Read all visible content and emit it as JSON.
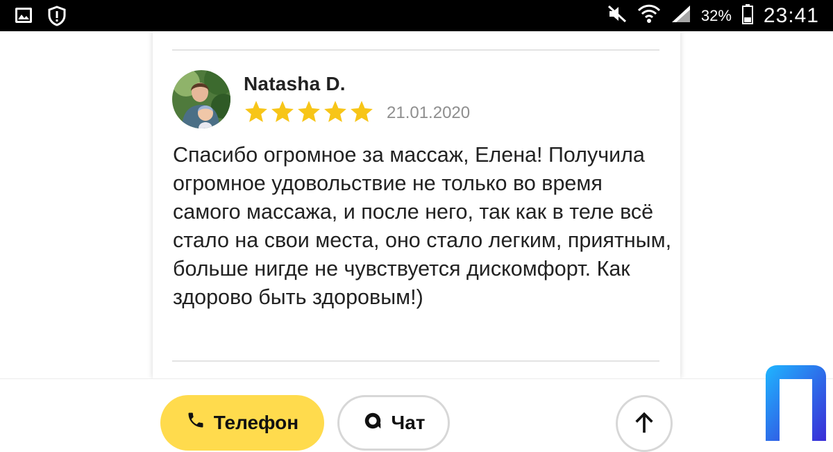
{
  "status_bar": {
    "left_icons": [
      "image-notification-icon",
      "shield-alert-icon"
    ],
    "right_icons": [
      "mute-icon",
      "wifi-icon",
      "signal-icon",
      "battery-icon"
    ],
    "battery_percent": "32%",
    "time": "23:41"
  },
  "review": {
    "author": "Natasha D.",
    "rating": 5,
    "rating_max": 5,
    "date": "21.01.2020",
    "text": "Спасибо огромное за массаж, Елена! Получила огромное удовольствие не только во время самого массажа, и после него, так как в теле всё стало на свои места, оно стало легким, приятным, больше нигде не чувствуется дискомфорт. Как здорово быть здоровым!)"
  },
  "actions": {
    "phone_label": "Телефон",
    "chat_label": "Чат"
  },
  "colors": {
    "star": "#f7c518",
    "phone_button": "#ffdb4d",
    "status_bar": "#000000",
    "text": "#222222",
    "date": "#8e8e8e"
  }
}
